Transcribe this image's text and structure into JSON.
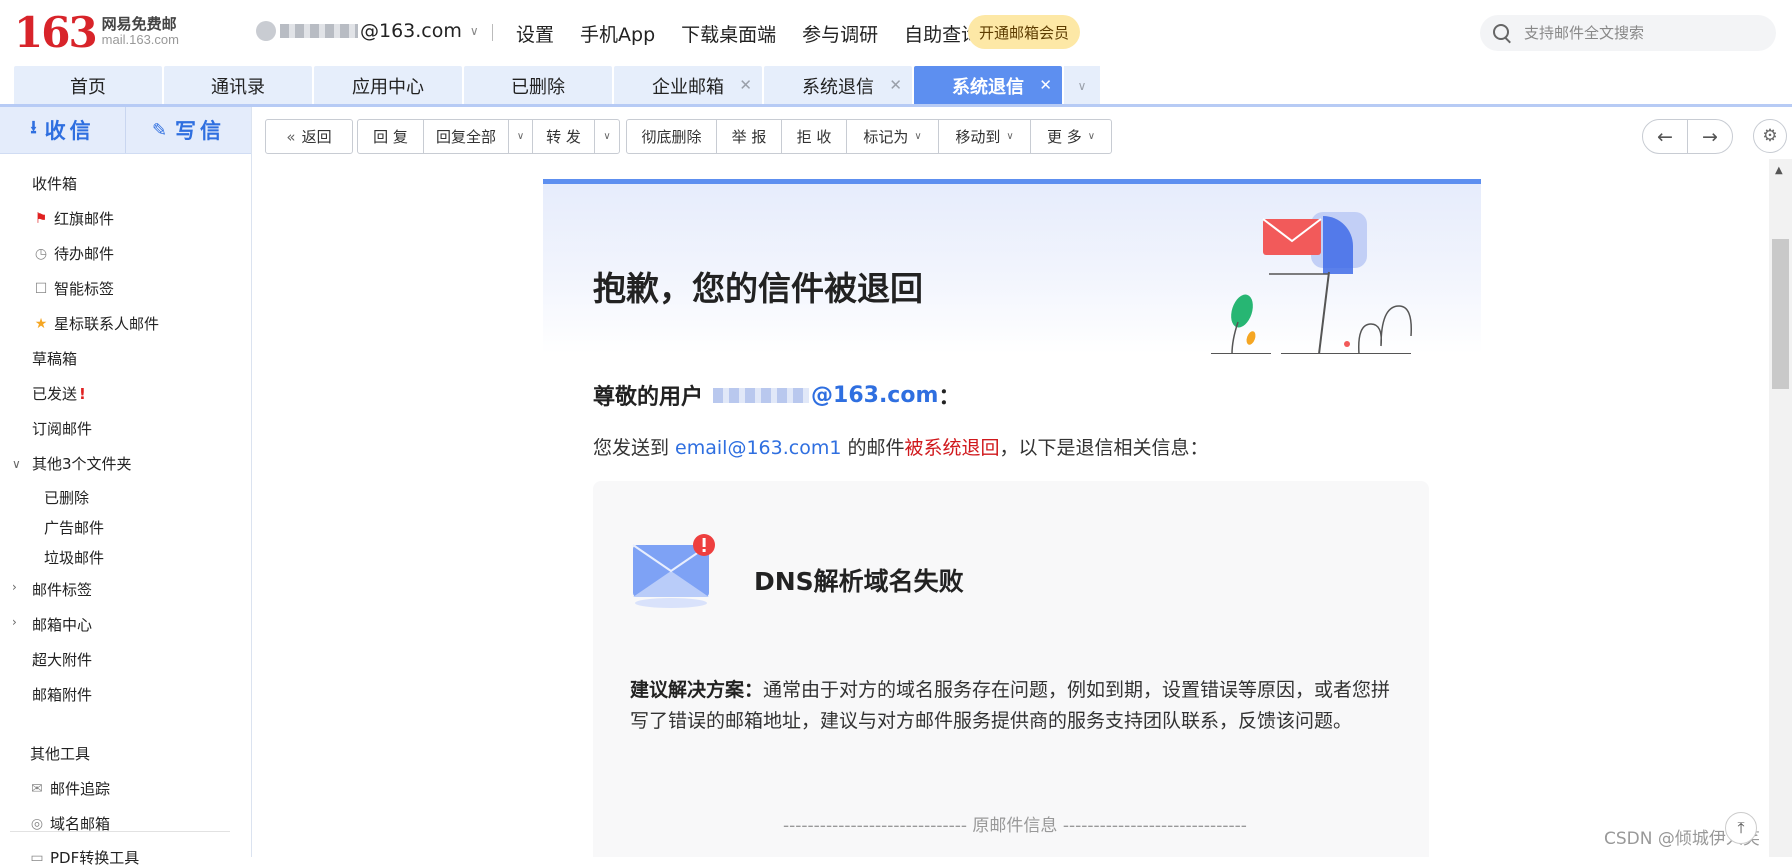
{
  "brand": {
    "number": "163",
    "name_cn": "网易免费邮",
    "domain": "mail.163.com"
  },
  "account": {
    "email_suffix": "@163.com"
  },
  "top_nav": [
    "设置",
    "手机App",
    "下载桌面端",
    "参与调研",
    "自助查询"
  ],
  "vip_button": "开通邮箱会员",
  "search": {
    "placeholder": "支持邮件全文搜索"
  },
  "tabs": [
    {
      "label": "首页",
      "closable": false,
      "active": false
    },
    {
      "label": "通讯录",
      "closable": false,
      "active": false
    },
    {
      "label": "应用中心",
      "closable": false,
      "active": false
    },
    {
      "label": "已删除",
      "closable": false,
      "active": false
    },
    {
      "label": "企业邮箱",
      "closable": true,
      "active": false
    },
    {
      "label": "系统退信",
      "closable": true,
      "active": false
    },
    {
      "label": "系统退信",
      "closable": true,
      "active": true
    }
  ],
  "compose": {
    "receive": "收信",
    "write": "写信"
  },
  "folders": {
    "inbox": "收件箱",
    "flagged": "红旗邮件",
    "todo": "待办邮件",
    "smart_tag": "智能标签",
    "star_contacts": "星标联系人邮件",
    "drafts": "草稿箱",
    "sent": "已发送",
    "sent_mark": "!",
    "subscriptions": "订阅邮件",
    "other_folders": "其他3个文件夹",
    "deleted": "已删除",
    "ads": "广告邮件",
    "junk": "垃圾邮件",
    "mail_tags": "邮件标签",
    "mail_center": "邮箱中心",
    "big_attachments": "超大附件",
    "attachments": "邮箱附件",
    "other_tools": "其他工具",
    "mail_tracking": "邮件追踪",
    "domain_mail": "域名邮箱",
    "pdf_tool": "PDF转换工具"
  },
  "toolbar": {
    "back": "返回",
    "reply": "回 复",
    "reply_all": "回复全部",
    "forward": "转 发",
    "delete_forever": "彻底删除",
    "report": "举 报",
    "reject": "拒 收",
    "mark_as": "标记为",
    "move_to": "移动到",
    "more": "更 多"
  },
  "message": {
    "title": "抱歉，您的信件被退回",
    "dear_prefix": "尊敬的用户",
    "dear_email_suffix": "@163.com",
    "dear_colon": "：",
    "line_prefix": "您发送到 ",
    "recipient": "email@163.com1",
    "line_mid": " 的邮件",
    "bounced": "被系统退回",
    "line_suffix": "，以下是退信相关信息：",
    "error_title": "DNS解析域名失败",
    "advice_label": "建议解决方案：",
    "advice_text": "通常由于对方的域名服务存在问题，例如到期，设置错误等原因，或者您拼写了错误的邮箱地址，建议与对方邮件服务提供商的服务支持团队联系，反馈该问题。",
    "original_divider": "------------------------------ 原邮件信息 ------------------------------"
  },
  "watermark": "CSDN @倾城伊人笑",
  "colors": {
    "accent": "#5d8ff0",
    "brand_red": "#d8242a",
    "link_blue": "#2f6fe0",
    "bounce_red": "#d0181c"
  }
}
